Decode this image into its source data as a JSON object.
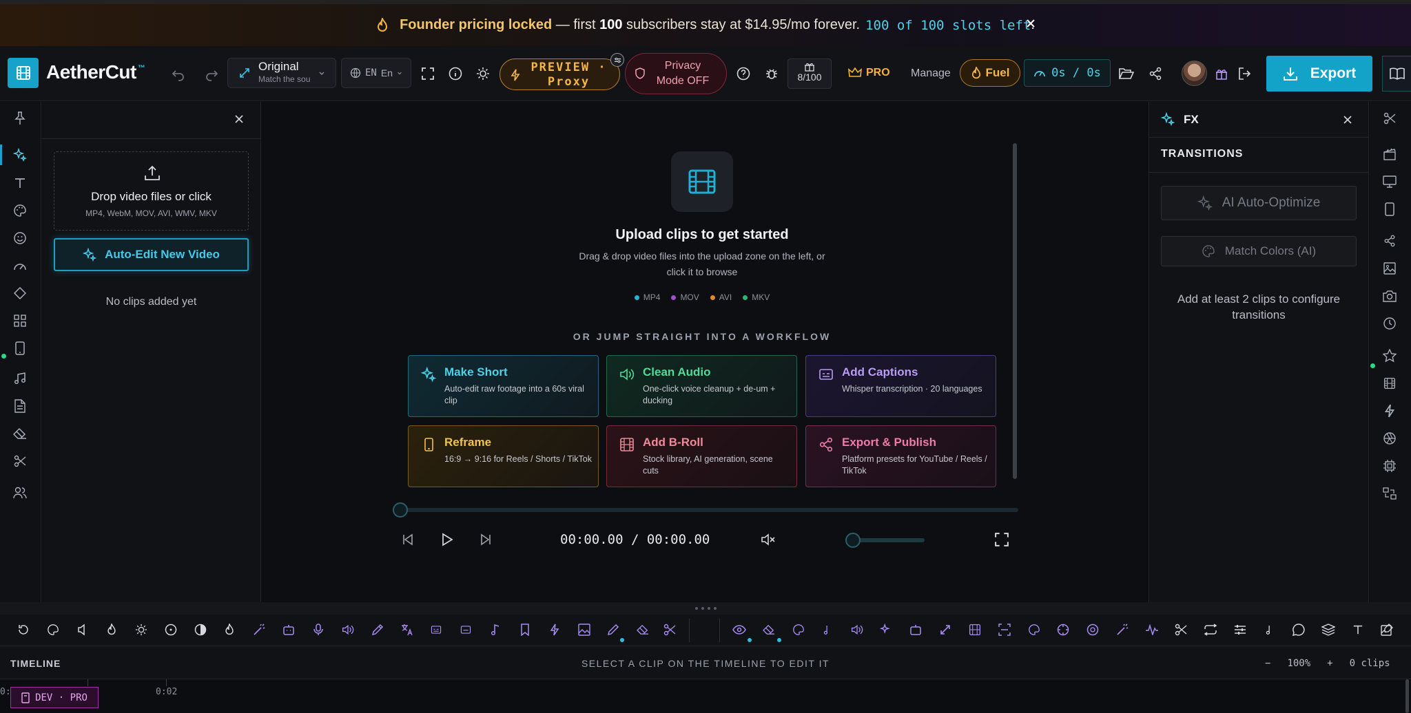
{
  "banner": {
    "pre": "Founder pricing locked",
    "mid1": " — first ",
    "count": "100",
    "mid2": " subscribers stay at $14.95/mo forever.",
    "slots": "100 of 100 slots left",
    "dot": "."
  },
  "header": {
    "brand": "AetherCut",
    "tm": "™",
    "aspect_label": "Original",
    "aspect_sub": "Match the sou",
    "lang_code": "EN",
    "lang_name": "En",
    "preview_line1": "PREVIEW ·",
    "preview_line2": "Proxy",
    "privacy_line1": "Privacy",
    "privacy_line2": "Mode OFF",
    "credits": "8/100",
    "pro": "PRO",
    "manage": "Manage",
    "fuel": "Fuel",
    "timer": "0s / 0s",
    "export": "Export"
  },
  "left_panel": {
    "drop_title": "Drop video files or click",
    "drop_formats": "MP4, WebM, MOV, AVI, WMV, MKV",
    "auto_edit": "Auto-Edit New Video",
    "empty": "No clips added yet"
  },
  "center": {
    "upload_title": "Upload clips to get started",
    "upload_sub": "Drag & drop video files into the upload zone on the left, or click it to browse",
    "formats": [
      {
        "label": "MP4",
        "color": "#22b6d6"
      },
      {
        "label": "MOV",
        "color": "#a54cd6"
      },
      {
        "label": "AVI",
        "color": "#e08a2a"
      },
      {
        "label": "MKV",
        "color": "#2bb673"
      }
    ],
    "or_jump": "OR JUMP STRAIGHT INTO A WORKFLOW",
    "cards": [
      {
        "title": "Make Short",
        "desc": "Auto-edit raw footage into a 60s viral clip",
        "color": "#4fd1e8"
      },
      {
        "title": "Clean Audio",
        "desc": "One-click voice cleanup + de-um + ducking",
        "color": "#4fdc9a"
      },
      {
        "title": "Add Captions",
        "desc": "Whisper transcription · 20 languages",
        "color": "#b79cf2"
      },
      {
        "title": "Reframe",
        "desc": "16:9 → 9:16 for Reels / Shorts / TikTok",
        "color": "#f2c34c"
      },
      {
        "title": "Add B-Roll",
        "desc": "Stock library, AI generation, scene cuts",
        "color": "#f08a9a"
      },
      {
        "title": "Export & Publish",
        "desc": "Platform presets for YouTube / Reels / TikTok",
        "color": "#f07aa8"
      }
    ],
    "timecode": "00:00.00 / 00:00.00",
    "playback_progress": 0,
    "volume_level": 0
  },
  "fx_panel": {
    "title": "FX",
    "section": "TRANSITIONS",
    "ai_optimize": "AI Auto-Optimize",
    "match_colors": "Match Colors (AI)",
    "note": "Add at least 2 clips to configure transitions"
  },
  "timeline": {
    "label": "TIMELINE",
    "hint": "SELECT A CLIP ON THE TIMELINE TO EDIT IT",
    "zoom_minus": "−",
    "zoom": "100%",
    "zoom_plus": "+",
    "clips": "0 clips",
    "tick_start": "0:",
    "tick_2": "0:02",
    "dev_badge": "DEV · PRO"
  },
  "colors": {
    "accent": "#14a3c8",
    "amber": "#f3b64b",
    "privacy": "#f2a0ae"
  }
}
